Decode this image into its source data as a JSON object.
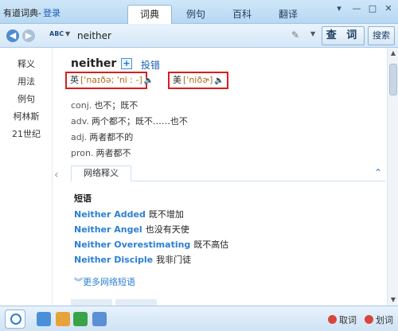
{
  "titlebar": {
    "app_name": "有道词典-",
    "login": "登录",
    "tabs": [
      "词典",
      "例句",
      "百科",
      "翻译"
    ],
    "active_tab": 0
  },
  "search": {
    "value": "neither",
    "lookup_label": "查 词",
    "search_label": "搜索"
  },
  "sidebar": {
    "items": [
      "释义",
      "用法",
      "例句",
      "柯林斯",
      "21世纪"
    ]
  },
  "entry": {
    "headword": "neither",
    "add_label": "投错",
    "uk_label": "英",
    "uk_ipa": "['naɪðə; 'ni ː -]",
    "us_label": "美",
    "us_ipa": "['niðɚ]",
    "definitions": [
      {
        "pos": "conj.",
        "text": "也不；既不"
      },
      {
        "pos": "adv.",
        "text": "两个都不；既不……也不"
      },
      {
        "pos": "adj.",
        "text": "两者都不的"
      },
      {
        "pos": "pron.",
        "text": "两者都不"
      }
    ]
  },
  "web": {
    "tab_label": "网络释义",
    "phrases_title": "短语",
    "phrases": [
      {
        "en": "Neither Added",
        "cn": "既不增加"
      },
      {
        "en": "Neither Angel",
        "cn": "也没有天使"
      },
      {
        "en": "Neither Overestimating",
        "cn": "既不高估"
      },
      {
        "en": "Neither Disciple",
        "cn": "我非门徒"
      }
    ],
    "more_label": "更多网络短语"
  },
  "statusbar": {
    "cancel_label": "取词",
    "select_label": "划词"
  },
  "colors": {
    "accent": "#2b7fd4",
    "highlight_box": "#d81e1e"
  }
}
